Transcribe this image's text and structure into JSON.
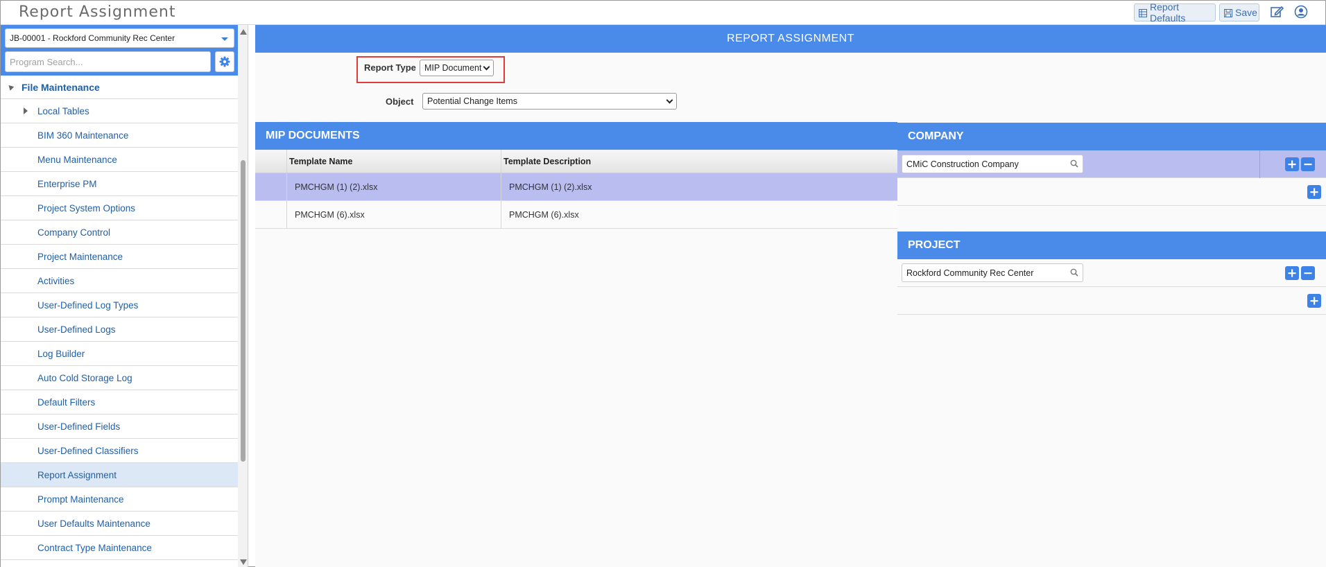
{
  "app": {
    "title": "Report Assignment"
  },
  "toolbar": {
    "report_defaults_label": "Report Defaults",
    "save_label": "Save"
  },
  "sidebar": {
    "project_selector": "JB-00001 - Rockford Community Rec Center",
    "search_placeholder": "Program Search...",
    "section_label": "File Maintenance",
    "items": [
      {
        "label": "Local Tables"
      },
      {
        "label": "BIM 360 Maintenance"
      },
      {
        "label": "Menu Maintenance"
      },
      {
        "label": "Enterprise PM"
      },
      {
        "label": "Project System Options"
      },
      {
        "label": "Company Control"
      },
      {
        "label": "Project Maintenance"
      },
      {
        "label": "Activities"
      },
      {
        "label": "User-Defined Log Types"
      },
      {
        "label": "User-Defined Logs"
      },
      {
        "label": "Log Builder"
      },
      {
        "label": "Auto Cold Storage Log"
      },
      {
        "label": "Default Filters"
      },
      {
        "label": "User-Defined Fields"
      },
      {
        "label": "User-Defined Classifiers"
      },
      {
        "label": "Report Assignment"
      },
      {
        "label": "Prompt Maintenance"
      },
      {
        "label": "User Defaults Maintenance"
      },
      {
        "label": "Contract Type Maintenance"
      }
    ]
  },
  "main": {
    "banner": "REPORT ASSIGNMENT",
    "report_type_label": "Report Type",
    "report_type_value": "MIP Document",
    "object_label": "Object",
    "object_value": "Potential Change Items",
    "mip_panel": {
      "title": "MIP DOCUMENTS",
      "columns": [
        "Template Name",
        "Template Description"
      ],
      "rows": [
        {
          "name": "PMCHGM (1) (2).xlsx",
          "description": "PMCHGM (1) (2).xlsx"
        },
        {
          "name": "PMCHGM (6).xlsx",
          "description": "PMCHGM (6).xlsx"
        }
      ]
    },
    "company_panel": {
      "title": "COMPANY",
      "value": "CMiC Construction Company"
    },
    "project_panel": {
      "title": "PROJECT",
      "value": "Rockford Community Rec Center"
    }
  },
  "colors": {
    "accent": "#4a8bea",
    "highlight": "#e03a3a",
    "selected_row": "#b9bdf0",
    "active_nav": "#dce8f5"
  }
}
